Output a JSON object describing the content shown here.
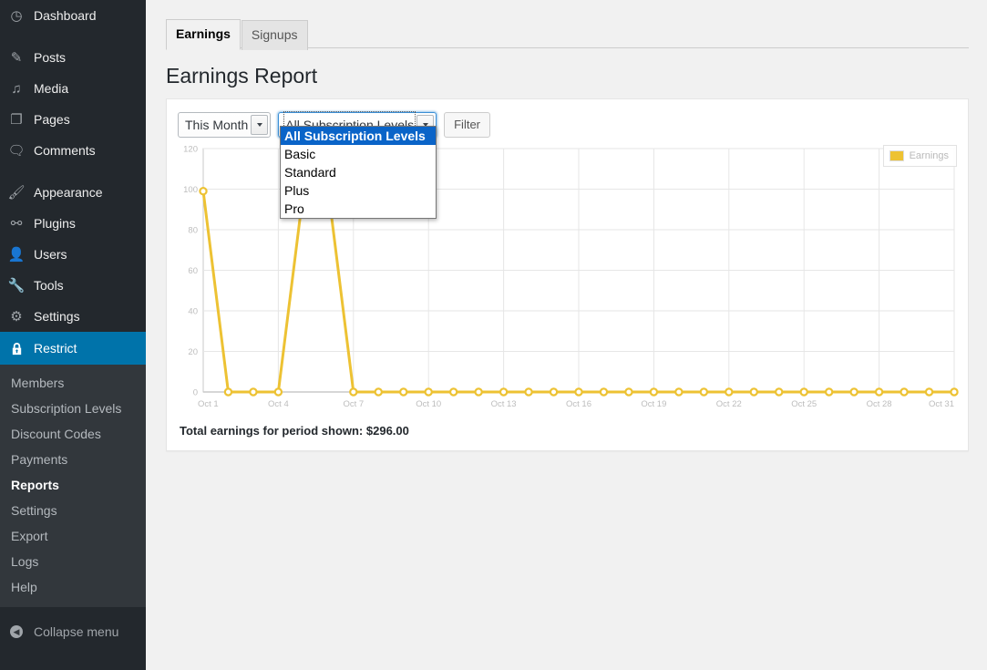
{
  "sidebar": {
    "items": [
      {
        "label": "Dashboard",
        "icon": "dashboard-icon",
        "glyph": "◷"
      },
      {
        "label": "Posts",
        "icon": "pin-icon",
        "glyph": "✎"
      },
      {
        "label": "Media",
        "icon": "media-icon",
        "glyph": "♫"
      },
      {
        "label": "Pages",
        "icon": "pages-icon",
        "glyph": "❐"
      },
      {
        "label": "Comments",
        "icon": "comments-icon",
        "glyph": "🗨"
      },
      {
        "label": "Appearance",
        "icon": "brush-icon",
        "glyph": "🖌"
      },
      {
        "label": "Plugins",
        "icon": "plug-icon",
        "glyph": "⚯"
      },
      {
        "label": "Users",
        "icon": "user-icon",
        "glyph": "👤"
      },
      {
        "label": "Tools",
        "icon": "wrench-icon",
        "glyph": "🔧"
      },
      {
        "label": "Settings",
        "icon": "settings-icon",
        "glyph": "⚙"
      }
    ],
    "current": {
      "label": "Restrict",
      "icon": "lock-icon",
      "glyph": "🔒"
    },
    "submenu": [
      {
        "label": "Members",
        "current": false
      },
      {
        "label": "Subscription Levels",
        "current": false
      },
      {
        "label": "Discount Codes",
        "current": false
      },
      {
        "label": "Payments",
        "current": false
      },
      {
        "label": "Reports",
        "current": true
      },
      {
        "label": "Settings",
        "current": false
      },
      {
        "label": "Export",
        "current": false
      },
      {
        "label": "Logs",
        "current": false
      },
      {
        "label": "Help",
        "current": false
      }
    ],
    "collapse_label": "Collapse menu",
    "highlight_color": "#0073aa"
  },
  "tabs": [
    {
      "label": "Earnings",
      "active": true
    },
    {
      "label": "Signups",
      "active": false
    }
  ],
  "page_title": "Earnings Report",
  "filters": {
    "period_select": {
      "value": "This Month"
    },
    "level_select": {
      "value": "All Subscription Levels",
      "open": true,
      "options": [
        "All Subscription Levels",
        "Basic",
        "Standard",
        "Plus",
        "Pro"
      ],
      "selected_index": 0
    },
    "filter_button": "Filter"
  },
  "total_text": "Total earnings for period shown: $296.00",
  "chart_data": {
    "type": "line",
    "title": "",
    "xlabel": "",
    "ylabel": "",
    "series_color": "#edc233",
    "legend": [
      "Earnings"
    ],
    "legend_position": "top-right",
    "grid": true,
    "ylim": [
      0,
      120
    ],
    "yticks": [
      0,
      20,
      40,
      60,
      80,
      100,
      120
    ],
    "x": [
      "Oct 1",
      "Oct 2",
      "Oct 3",
      "Oct 4",
      "Oct 5",
      "Oct 6",
      "Oct 7",
      "Oct 8",
      "Oct 9",
      "Oct 10",
      "Oct 11",
      "Oct 12",
      "Oct 13",
      "Oct 14",
      "Oct 15",
      "Oct 16",
      "Oct 17",
      "Oct 18",
      "Oct 19",
      "Oct 20",
      "Oct 21",
      "Oct 22",
      "Oct 23",
      "Oct 24",
      "Oct 25",
      "Oct 26",
      "Oct 27",
      "Oct 28",
      "Oct 29",
      "Oct 30",
      "Oct 31"
    ],
    "xtick_labels": [
      "Oct 1",
      "Oct 4",
      "Oct 7",
      "Oct 10",
      "Oct 13",
      "Oct 16",
      "Oct 19",
      "Oct 22",
      "Oct 25",
      "Oct 28",
      "Oct 31"
    ],
    "series": [
      {
        "name": "Earnings",
        "values": [
          99,
          0,
          0,
          0,
          99,
          99,
          0,
          0,
          0,
          0,
          0,
          0,
          0,
          0,
          0,
          0,
          0,
          0,
          0,
          0,
          0,
          0,
          0,
          0,
          0,
          0,
          0,
          0,
          0,
          0,
          0
        ]
      }
    ]
  }
}
